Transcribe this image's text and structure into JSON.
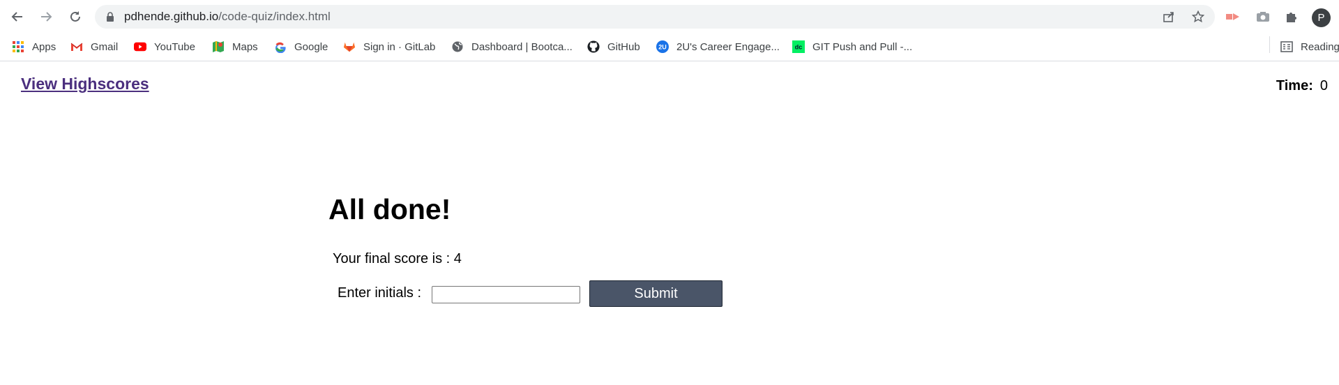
{
  "browser": {
    "url_host": "pdhende.github.io",
    "url_path": "/code-quiz/index.html",
    "profile_initial": "P",
    "reading_list_label": "Reading"
  },
  "bookmarks": [
    {
      "label": "Apps",
      "icon": "apps-grid-icon"
    },
    {
      "label": "Gmail",
      "icon": "gmail-icon"
    },
    {
      "label": "YouTube",
      "icon": "youtube-icon"
    },
    {
      "label": "Maps",
      "icon": "maps-icon"
    },
    {
      "label": "Google",
      "icon": "google-icon"
    },
    {
      "label": "Sign in · GitLab",
      "icon": "gitlab-icon"
    },
    {
      "label": "Dashboard | Bootca...",
      "icon": "globe-icon"
    },
    {
      "label": "GitHub",
      "icon": "github-icon"
    },
    {
      "label": "2U's Career Engage...",
      "icon": "2u-icon"
    },
    {
      "label": "GIT Push and Pull -...",
      "icon": "dc-icon"
    }
  ],
  "page": {
    "highscores_link": "View Highscores",
    "timer_label": "Time:",
    "timer_value": "0",
    "title": "All done!",
    "score_text": "Your final score is : 4",
    "initials_label": "Enter initials :",
    "initials_value": "",
    "submit_label": "Submit"
  },
  "colors": {
    "link": "#4b2f7e",
    "submit_bg": "#4a5568",
    "omnibox_bg": "#f1f3f4"
  }
}
